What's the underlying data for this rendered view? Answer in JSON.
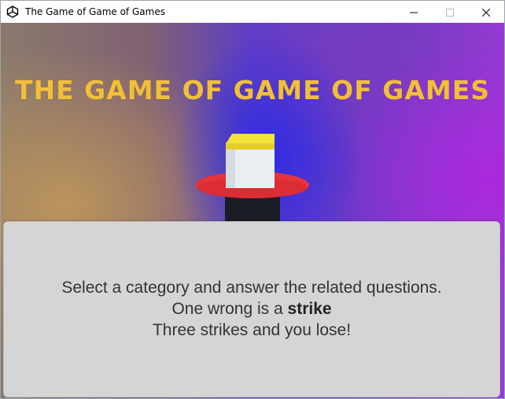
{
  "window": {
    "title": "The Game of Game of Games",
    "controls": [
      "minimize-icon",
      "maximize-icon",
      "close-icon"
    ]
  },
  "game": {
    "title": "THE GAME OF GAME OF GAMES",
    "title_color": "#f1bf3a",
    "platform_color": "#e8323a",
    "cube_top_color": "#f3e23a",
    "cube_body_color": "#e9eef3"
  },
  "panel": {
    "line1": "Select a category and answer the related questions.",
    "line2_prefix": "One wrong is a ",
    "line2_bold": "strike",
    "line3": "Three strikes and you lose!"
  }
}
